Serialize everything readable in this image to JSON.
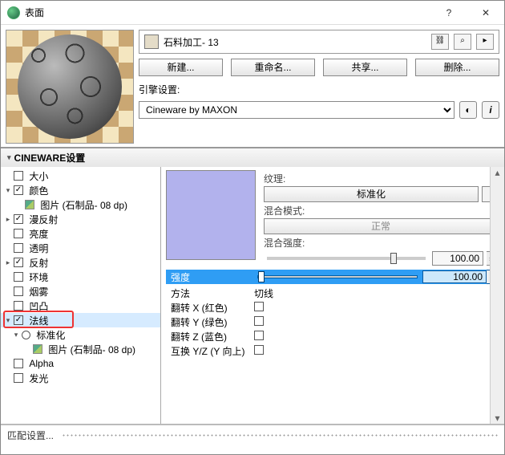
{
  "window": {
    "title": "表面"
  },
  "material": {
    "name": "石料加工- 13"
  },
  "buttons": {
    "new": "新建...",
    "rename": "重命名...",
    "share": "共享...",
    "delete": "删除..."
  },
  "engine": {
    "label": "引擎设置:",
    "selected": "Cineware by MAXON"
  },
  "section": {
    "title": "CINEWARE设置"
  },
  "tree": {
    "size": "大小",
    "color": "颜色",
    "img": "图片 (石制品- 08 dp)",
    "diffuse": "漫反射",
    "brightness": "亮度",
    "transparent": "透明",
    "reflect": "反射",
    "environment": "环境",
    "fog": "烟雾",
    "bump": "凹凸",
    "normal": "法线",
    "normalize": "标准化",
    "img2": "图片 (石制品- 08 dp)",
    "alpha": "Alpha",
    "glow": "发光"
  },
  "props": {
    "texture": "纹理:",
    "normalizeBtn": "标准化",
    "blendMode": "混合模式:",
    "normalBtn": "正常",
    "blendStrength": "混合强度:",
    "blendValue": "100.00",
    "intensity": "强度",
    "intensityValue": "100.00",
    "method": "方法",
    "tangent": "切线",
    "flipX": "翻转 X (红色)",
    "flipY": "翻转 Y (绿色)",
    "flipZ": "翻转 Z (蓝色)",
    "swapYZ": "互换 Y/Z (Y 向上)"
  },
  "footer": {
    "match": "匹配设置..."
  }
}
